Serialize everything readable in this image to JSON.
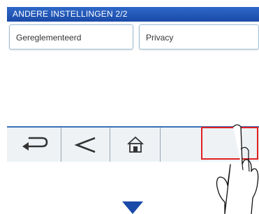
{
  "header": {
    "title": "ANDERE INSTELLINGEN 2/2"
  },
  "menu": {
    "options": [
      {
        "label": "Gereglementeerd"
      },
      {
        "label": "Privacy"
      }
    ]
  },
  "toolbar": {
    "buttons": [
      {
        "icon": "back-return-icon"
      },
      {
        "icon": "chevron-left-icon"
      },
      {
        "icon": "home-icon"
      }
    ]
  },
  "instruction": {
    "pointer_icon": "pointing-hand-icon",
    "next_icon": "down-arrow-icon",
    "highlight_color": "#e02020",
    "accent_color": "#1a4aa8"
  }
}
